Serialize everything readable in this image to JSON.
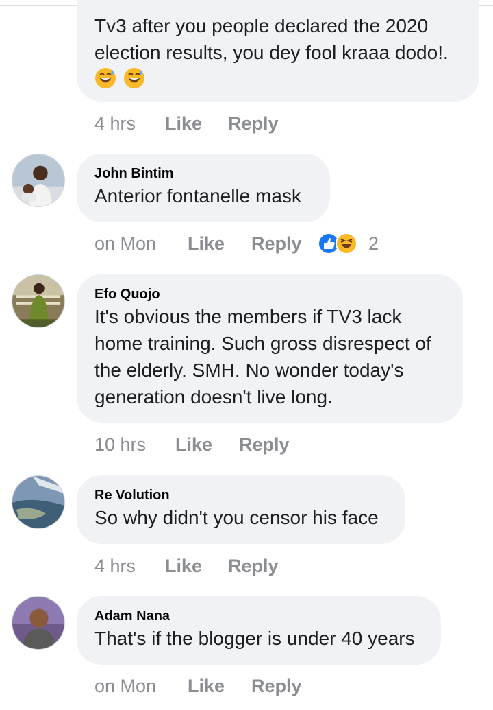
{
  "first_comment": {
    "text": "Tv3 after you people declared the 2020\nelection results, you dey fool kraaa dodo!.",
    "emojis": [
      "grinning-sweat-emoji",
      "grinning-sweat-emoji"
    ],
    "time": "4 hrs",
    "like_label": "Like",
    "reply_label": "Reply"
  },
  "comments": [
    {
      "author": "John Bintim",
      "text": "Anterior fontanelle mask",
      "time": "on Mon",
      "like_label": "Like",
      "reply_label": "Reply",
      "reactions": {
        "icons": [
          "like-reaction-icon",
          "haha-reaction-icon"
        ],
        "count": "2"
      }
    },
    {
      "author": "Efo Quojo",
      "text": "It's obvious the members if TV3 lack\nhome training. Such gross disrespect of\nthe elderly. SMH. No wonder today's\ngeneration doesn't live long.",
      "time": "10 hrs",
      "like_label": "Like",
      "reply_label": "Reply"
    },
    {
      "author": "Re Volution",
      "text": "So why didn't you censor his face",
      "time": "4 hrs",
      "like_label": "Like",
      "reply_label": "Reply"
    },
    {
      "author": "Adam Nana",
      "text": "That's if the blogger is under 40 years",
      "time": "on Mon",
      "like_label": "Like",
      "reply_label": "Reply"
    }
  ],
  "colors": {
    "bubble": "#f0f2f5",
    "meta_text": "#8a8d91",
    "like_blue": "#1877f2",
    "haha_yellow": "#f7b928"
  }
}
